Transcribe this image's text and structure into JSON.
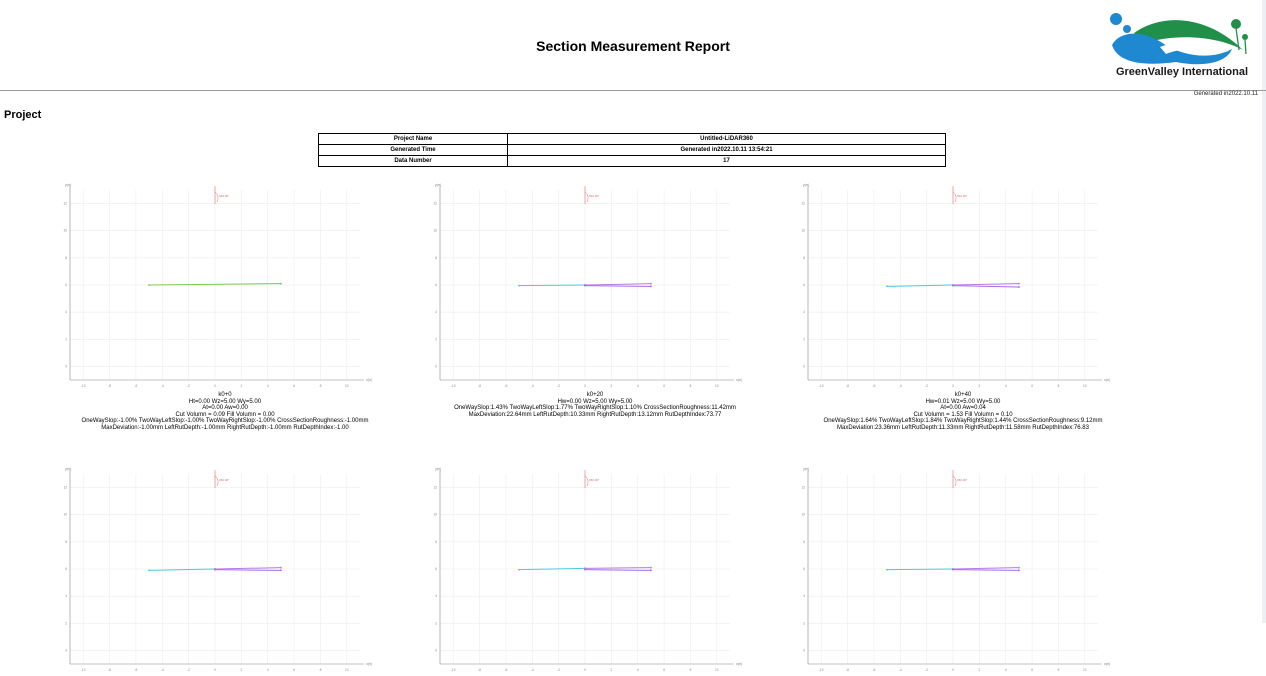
{
  "header": {
    "title": "Section Measurement Report",
    "logo_text": "GreenValley International",
    "generated": "Generated in2022.10.11",
    "brand_colors": {
      "blue": "#1e88d0",
      "green": "#1f8f4a"
    }
  },
  "section_title": "Project",
  "project_table": [
    {
      "key": "Project Name",
      "value": "Untitled-LiDAR360"
    },
    {
      "key": "Generated Time",
      "value": "Generated in2022.10.11 13:54:21"
    },
    {
      "key": "Data Number",
      "value": "17"
    }
  ],
  "charts": [
    {
      "x_label": "x(m)",
      "y_label": "y(m)",
      "x_ticks": [
        -10,
        -8,
        -6,
        -4,
        -2,
        0,
        2,
        4,
        6,
        8,
        10
      ],
      "y_ticks": [
        -2,
        0,
        2,
        4,
        6,
        8,
        10,
        12
      ],
      "slope_label": "360.00°",
      "series": [
        {
          "color": "#7cc94a",
          "points": [
            [
              -5,
              6
            ],
            [
              5,
              6.1
            ]
          ]
        }
      ],
      "caption": [
        "k0+0",
        "Ht=0.00 Wz=5.00 Wy=5.00",
        "At=0.00 Aw=0.00",
        "Cut Volumn = 0.09 Fill Volumn = 0.00",
        "OneWaySlop:-1.00% TwoWayLeftSlop:-1.00% TwoWayRightSlop:-1.00% CrossSectionRoughness:-1.00mm",
        "MaxDeviation:-1.00mm LeftRutDepth:-1.00mm RightRutDepth:-1.00mm RutDepthIndex:-1.00"
      ]
    },
    {
      "x_label": "x(m)",
      "y_label": "y(m)",
      "x_ticks": [
        -10,
        -8,
        -6,
        -4,
        -2,
        0,
        2,
        4,
        6,
        8,
        10
      ],
      "y_ticks": [
        -2,
        0,
        2,
        4,
        6,
        8,
        10,
        12
      ],
      "slope_label": "360.00°",
      "series": [
        {
          "color": "#4dc8e0",
          "points": [
            [
              -5,
              5.95
            ],
            [
              0,
              6.0
            ]
          ]
        },
        {
          "color": "#b77ae8",
          "points": [
            [
              0,
              6.0
            ],
            [
              5,
              6.1
            ]
          ]
        },
        {
          "color": "#a96be6",
          "points": [
            [
              0,
              5.95
            ],
            [
              5,
              5.9
            ]
          ]
        }
      ],
      "caption": [
        "k0+20",
        "Hw=0.00 Wz=5.00 Wy=5.00",
        "OneWaySlop:1.43% TwoWayLeftSlop:1.77% TwoWayRightSlop:1.10% CrossSectionRoughness:11.42mm",
        "MaxDeviation:22.64mm LeftRutDepth:10.33mm RightRutDepth:13.12mm RutDepthIndex:73.77"
      ]
    },
    {
      "x_label": "x(m)",
      "y_label": "y(m)",
      "x_ticks": [
        -10,
        -8,
        -6,
        -4,
        -2,
        0,
        2,
        4,
        6,
        8,
        10
      ],
      "y_ticks": [
        -2,
        0,
        2,
        4,
        6,
        8,
        10,
        12
      ],
      "slope_label": "360.00°",
      "series": [
        {
          "color": "#4dc8e0",
          "points": [
            [
              -5,
              5.9
            ],
            [
              0,
              6.0
            ]
          ]
        },
        {
          "color": "#b77ae8",
          "points": [
            [
              0,
              6.0
            ],
            [
              5,
              6.1
            ]
          ]
        },
        {
          "color": "#a96be6",
          "points": [
            [
              0,
              5.95
            ],
            [
              5,
              5.85
            ]
          ]
        }
      ],
      "caption": [
        "k0+40",
        "Hw=0.01 Wz=5.00 Wy=5.00",
        "At=0.00 Aw=0.04",
        "Cut Volumn = 1.53 Fill Volumn = 0.10",
        "OneWaySlop:1.64% TwoWayLeftSlop:1.84% TwoWayRightSlop:1.44% CrossSectionRoughness:9.12mm",
        "MaxDeviation:23.36mm LeftRutDepth:11.33mm RightRutDepth:11.58mm RutDepthIndex:76.83"
      ]
    },
    {
      "x_label": "x(m)",
      "y_label": "y(m)",
      "x_ticks": [
        -10,
        -8,
        -6,
        -4,
        -2,
        0,
        2,
        4,
        6,
        8,
        10
      ],
      "y_ticks": [
        -2,
        0,
        2,
        4,
        6,
        8,
        10,
        12
      ],
      "slope_label": "360.00°",
      "series": [
        {
          "color": "#4dc8e0",
          "points": [
            [
              -5,
              5.9
            ],
            [
              0,
              6.0
            ]
          ]
        },
        {
          "color": "#b77ae8",
          "points": [
            [
              0,
              6.0
            ],
            [
              5,
              6.1
            ]
          ]
        },
        {
          "color": "#a96be6",
          "points": [
            [
              0,
              5.95
            ],
            [
              5,
              5.9
            ]
          ]
        }
      ],
      "caption": []
    },
    {
      "x_label": "x(m)",
      "y_label": "y(m)",
      "x_ticks": [
        -10,
        -8,
        -6,
        -4,
        -2,
        0,
        2,
        4,
        6,
        8,
        10
      ],
      "y_ticks": [
        -2,
        0,
        2,
        4,
        6,
        8,
        10,
        12
      ],
      "slope_label": "360.00°",
      "series": [
        {
          "color": "#4dc8e0",
          "points": [
            [
              -5,
              5.95
            ],
            [
              0,
              6.05
            ]
          ]
        },
        {
          "color": "#b77ae8",
          "points": [
            [
              0,
              6.05
            ],
            [
              5,
              6.1
            ]
          ]
        },
        {
          "color": "#a96be6",
          "points": [
            [
              0,
              5.95
            ],
            [
              5,
              5.9
            ]
          ]
        }
      ],
      "caption": []
    },
    {
      "x_label": "x(m)",
      "y_label": "y(m)",
      "x_ticks": [
        -10,
        -8,
        -6,
        -4,
        -2,
        0,
        2,
        4,
        6,
        8,
        10
      ],
      "y_ticks": [
        -2,
        0,
        2,
        4,
        6,
        8,
        10,
        12
      ],
      "slope_label": "360.00°",
      "series": [
        {
          "color": "#4dc8e0",
          "points": [
            [
              -5,
              5.95
            ],
            [
              0,
              6.0
            ]
          ]
        },
        {
          "color": "#b77ae8",
          "points": [
            [
              0,
              6.0
            ],
            [
              5,
              6.1
            ]
          ]
        },
        {
          "color": "#a96be6",
          "points": [
            [
              0,
              5.95
            ],
            [
              5,
              5.9
            ]
          ]
        }
      ],
      "caption": []
    }
  ]
}
